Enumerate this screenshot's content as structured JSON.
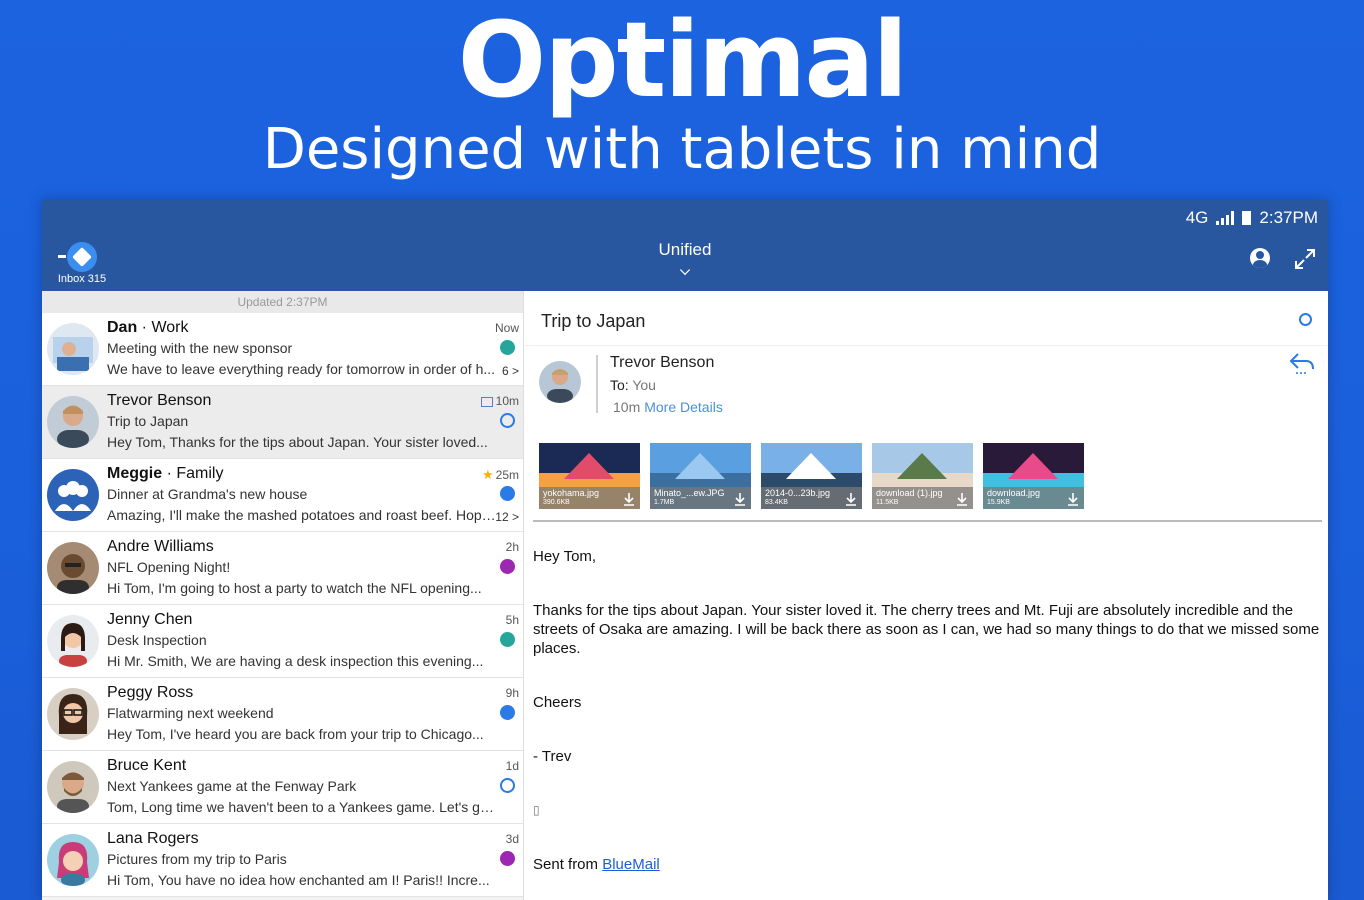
{
  "hero": {
    "title": "Optimal",
    "subtitle": "Designed with tablets in mind"
  },
  "statusbar": {
    "network": "4G",
    "time": "2:37PM"
  },
  "appbar": {
    "inbox_label": "Inbox 315",
    "account": "Unified"
  },
  "list": {
    "updated": "Updated 2:37PM",
    "items": [
      {
        "sender": "Dan",
        "group": "Work",
        "subject": "Meeting with the new sponsor",
        "preview": "We have to leave everything ready for tomorrow in order of h...",
        "time": "Now",
        "count": "6 >",
        "dot_color": "#26a69a"
      },
      {
        "sender": "Trevor Benson",
        "group": "",
        "subject": "Trip to Japan",
        "preview": "Hey Tom, Thanks for the tips about Japan. Your sister loved...",
        "time": "10m",
        "count": "",
        "dot_color": "ring"
      },
      {
        "sender": "Meggie",
        "group": "Family",
        "subject": "Dinner at Grandma's new house",
        "preview": "Amazing, I'll make the mashed potatoes and roast beef. Hope...",
        "time": "25m",
        "count": "12 >",
        "dot_color": "#2a7ae8"
      },
      {
        "sender": "Andre Williams",
        "group": "",
        "subject": "NFL Opening Night!",
        "preview": "Hi Tom, I'm going to host a party to watch the NFL opening...",
        "time": "2h",
        "count": "",
        "dot_color": "#9c27b0"
      },
      {
        "sender": "Jenny Chen",
        "group": "",
        "subject": "Desk Inspection",
        "preview": "Hi Mr. Smith, We are having a desk inspection this evening...",
        "time": "5h",
        "count": "",
        "dot_color": "#26a69a"
      },
      {
        "sender": "Peggy Ross",
        "group": "",
        "subject": "Flatwarming next weekend",
        "preview": "Hey Tom, I've heard you are back from your trip to Chicago...",
        "time": "9h",
        "count": "",
        "dot_color": "#2a7ae8"
      },
      {
        "sender": "Bruce Kent",
        "group": "",
        "subject": "Next Yankees game at the Fenway Park",
        "preview": "Tom, Long time we haven't been to a Yankees game. Let's go...",
        "time": "1d",
        "count": "",
        "dot_color": "ring"
      },
      {
        "sender": "Lana Rogers",
        "group": "",
        "subject": "Pictures from my trip to Paris",
        "preview": "Hi Tom, You have no idea how enchanted am I! Paris!! Incre...",
        "time": "3d",
        "count": "",
        "dot_color": "#9c27b0"
      }
    ]
  },
  "reader": {
    "subject": "Trip to Japan",
    "from": "Trevor Benson",
    "to_label": "To:",
    "to_value": "You",
    "time": "10m",
    "more_details": "More Details",
    "attachments": [
      {
        "name": "yokohama.jpg",
        "size": "390.6KB"
      },
      {
        "name": "Minato_...ew.JPG",
        "size": "1.7MB"
      },
      {
        "name": "2014-0...23b.jpg",
        "size": "83.4KB"
      },
      {
        "name": "download (1).jpg",
        "size": "11.5KB"
      },
      {
        "name": "download.jpg",
        "size": "15.9KB"
      }
    ],
    "greeting": "Hey Tom,",
    "paragraph": "Thanks for the tips about Japan. Your sister loved it. The cherry trees and Mt. Fuji are absolutely incredible and the streets of Osaka are amazing. I will be back there as soon as I can, we had so many things to do that we missed some places.",
    "signoff": "Cheers",
    "signature": "- Trev",
    "glyph": "▯",
    "sent_from": "Sent from",
    "sent_link": "BlueMail"
  }
}
